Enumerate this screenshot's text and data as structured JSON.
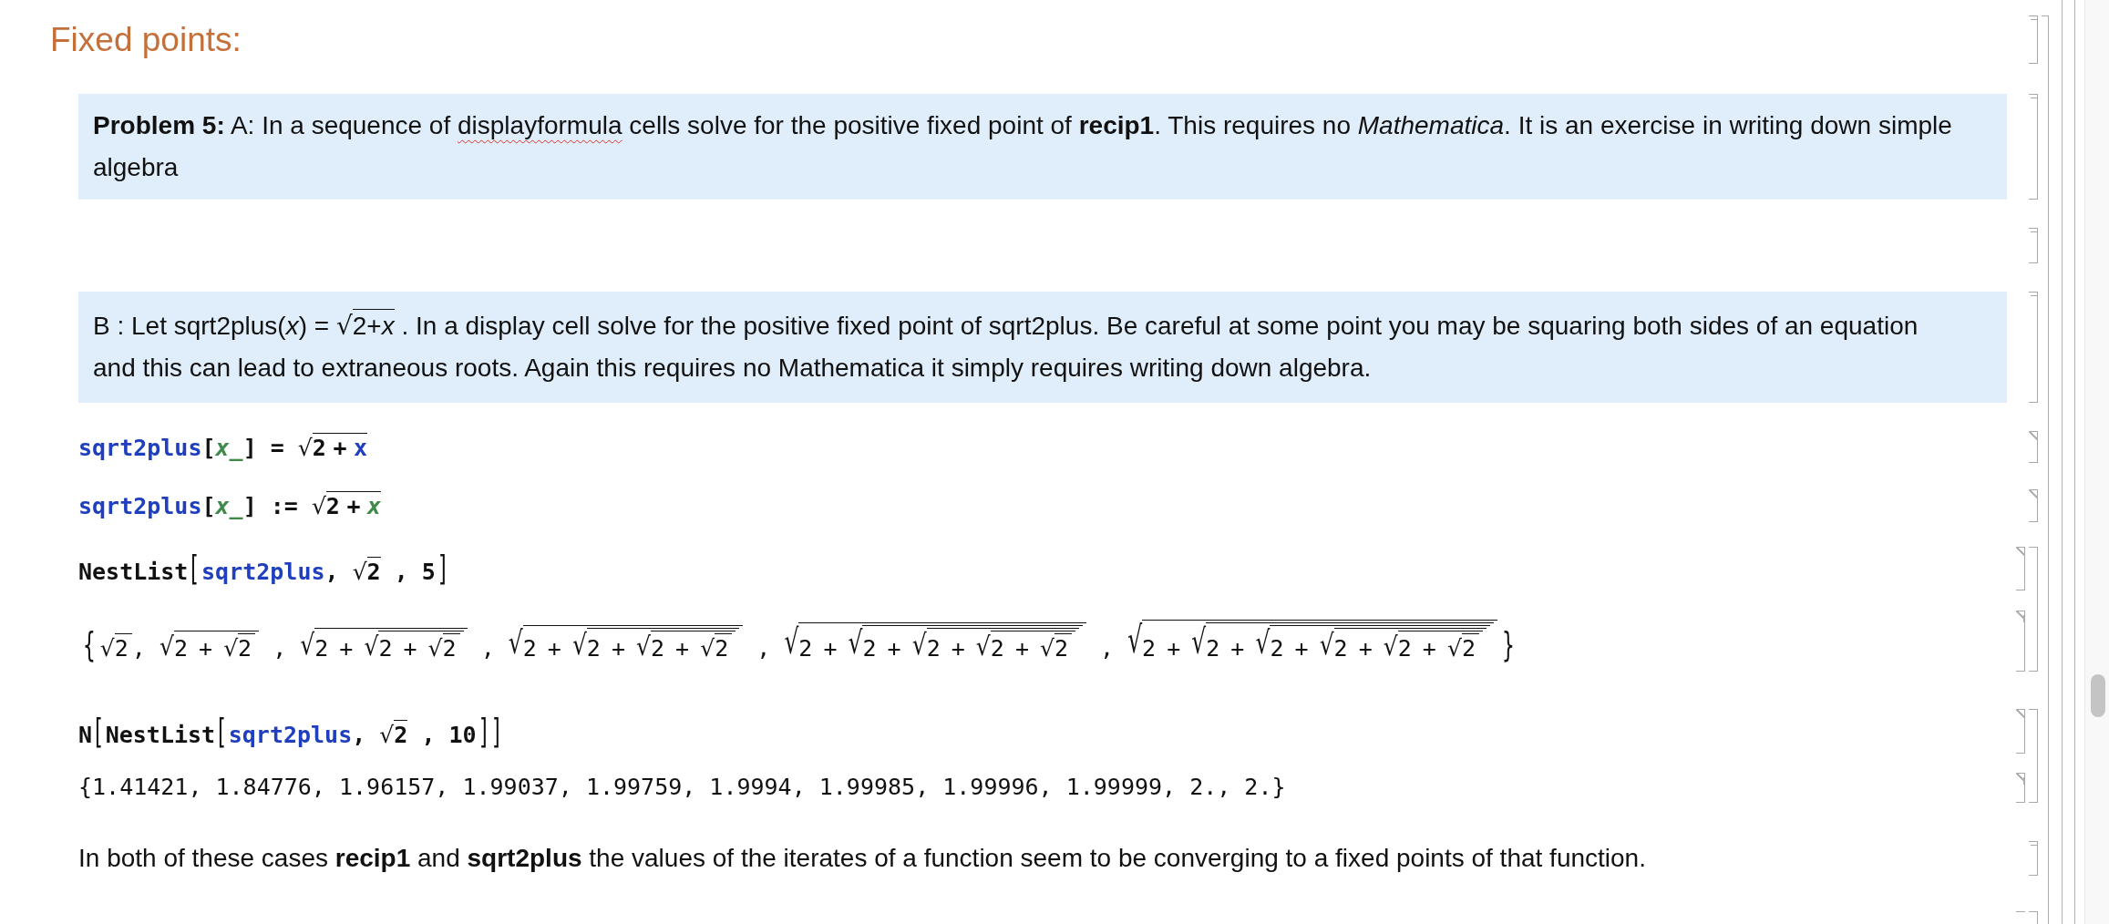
{
  "cells": [
    {
      "kind": "section_title",
      "title": "Fixed points:"
    },
    {
      "kind": "text_box",
      "paragraph": [
        {
          "kind": "bold",
          "text": "Problem 5:"
        },
        {
          "kind": "plain",
          "text": " A: In a sequence of "
        },
        {
          "kind": "misspelled",
          "text": "displayformula"
        },
        {
          "kind": "plain",
          "text": " cells solve for the positive fixed point of "
        },
        {
          "kind": "bold",
          "text": "recip1"
        },
        {
          "kind": "plain",
          "text": ". This requires no "
        },
        {
          "kind": "italic",
          "text": "Mathematica"
        },
        {
          "kind": "plain",
          "text": ". It is an exercise in writing down simple algebra"
        }
      ]
    },
    {
      "kind": "empty"
    },
    {
      "kind": "text_box",
      "paragraph": [
        {
          "kind": "plain",
          "text": "B : Let sqrt2plus("
        },
        {
          "kind": "italic",
          "text": "x"
        },
        {
          "kind": "plain",
          "text": ") = "
        },
        {
          "kind": "sqrt",
          "sign": "√",
          "body": [
            {
              "kind": "plain",
              "text": "2+"
            },
            {
              "kind": "italic",
              "text": "x"
            }
          ]
        },
        {
          "kind": "plain",
          "text": " . In a display cell solve for the positive fixed point of sqrt2plus. Be careful at some point you may be squaring both sides of an equation and this can lead to extraneous roots. Again this requires no Mathematica it simply requires writing down algebra."
        }
      ]
    },
    {
      "kind": "input",
      "code": [
        {
          "kind": "symbol",
          "text": "sqrt2plus"
        },
        {
          "kind": "plain",
          "text": "["
        },
        {
          "kind": "pattern",
          "text": "x_"
        },
        {
          "kind": "plain",
          "text": "] = "
        },
        {
          "kind": "sqrt",
          "sign": "√",
          "body": [
            {
              "kind": "plain",
              "text": "2 + "
            },
            {
              "kind": "symbol",
              "text": "x"
            }
          ]
        }
      ]
    },
    {
      "kind": "input",
      "code": [
        {
          "kind": "symbol",
          "text": "sqrt2plus"
        },
        {
          "kind": "plain",
          "text": "["
        },
        {
          "kind": "pattern",
          "text": "x_"
        },
        {
          "kind": "plain",
          "text": "] := "
        },
        {
          "kind": "sqrt",
          "sign": "√",
          "body": [
            {
              "kind": "plain",
              "text": "2 + "
            },
            {
              "kind": "pattern",
              "text": "x"
            }
          ]
        }
      ]
    },
    {
      "kind": "group",
      "cells": [
        {
          "kind": "input",
          "code": [
            {
              "kind": "plain",
              "text": "NestList"
            },
            {
              "kind": "big_bracket",
              "text": "["
            },
            {
              "kind": "symbol",
              "text": "sqrt2plus"
            },
            {
              "kind": "plain",
              "text": ", "
            },
            {
              "kind": "sqrt",
              "sign": "√",
              "body": [
                {
                  "kind": "plain",
                  "text": "2"
                }
              ]
            },
            {
              "kind": "plain",
              "text": " , 5"
            },
            {
              "kind": "big_bracket",
              "text": "]"
            }
          ]
        },
        {
          "kind": "output",
          "code": [
            {
              "kind": "big_bracket",
              "text": "{"
            },
            {
              "kind": "sqrt",
              "sign": "√",
              "body": [
                {
                  "kind": "plain",
                  "text": "2"
                }
              ]
            },
            {
              "kind": "plain",
              "text": ", "
            },
            {
              "kind": "sqrt",
              "sign": "√",
              "body": [
                {
                  "kind": "plain",
                  "text": "2 + "
                },
                {
                  "kind": "sqrt",
                  "sign": "√",
                  "body": [
                    {
                      "kind": "plain",
                      "text": "2"
                    }
                  ]
                }
              ]
            },
            {
              "kind": "plain",
              "text": " , "
            },
            {
              "kind": "sqrt",
              "sign": "√",
              "body": [
                {
                  "kind": "plain",
                  "text": "2 + "
                },
                {
                  "kind": "sqrt",
                  "sign": "√",
                  "body": [
                    {
                      "kind": "plain",
                      "text": "2 + "
                    },
                    {
                      "kind": "sqrt",
                      "sign": "√",
                      "body": [
                        {
                          "kind": "plain",
                          "text": "2"
                        }
                      ]
                    }
                  ]
                }
              ]
            },
            {
              "kind": "plain",
              "text": " , "
            },
            {
              "kind": "sqrt",
              "sign": "√",
              "body": [
                {
                  "kind": "plain",
                  "text": "2 + "
                },
                {
                  "kind": "sqrt",
                  "sign": "√",
                  "body": [
                    {
                      "kind": "plain",
                      "text": "2 + "
                    },
                    {
                      "kind": "sqrt",
                      "sign": "√",
                      "body": [
                        {
                          "kind": "plain",
                          "text": "2 + "
                        },
                        {
                          "kind": "sqrt",
                          "sign": "√",
                          "body": [
                            {
                              "kind": "plain",
                              "text": "2"
                            }
                          ]
                        }
                      ]
                    }
                  ]
                }
              ]
            },
            {
              "kind": "plain",
              "text": " , "
            },
            {
              "kind": "sqrt",
              "sign": "√",
              "body": [
                {
                  "kind": "plain",
                  "text": "2 + "
                },
                {
                  "kind": "sqrt",
                  "sign": "√",
                  "body": [
                    {
                      "kind": "plain",
                      "text": "2 + "
                    },
                    {
                      "kind": "sqrt",
                      "sign": "√",
                      "body": [
                        {
                          "kind": "plain",
                          "text": "2 + "
                        },
                        {
                          "kind": "sqrt",
                          "sign": "√",
                          "body": [
                            {
                              "kind": "plain",
                              "text": "2 + "
                            },
                            {
                              "kind": "sqrt",
                              "sign": "√",
                              "body": [
                                {
                                  "kind": "plain",
                                  "text": "2"
                                }
                              ]
                            }
                          ]
                        }
                      ]
                    }
                  ]
                }
              ]
            },
            {
              "kind": "plain",
              "text": " , "
            },
            {
              "kind": "sqrt",
              "sign": "√",
              "body": [
                {
                  "kind": "plain",
                  "text": "2 + "
                },
                {
                  "kind": "sqrt",
                  "sign": "√",
                  "body": [
                    {
                      "kind": "plain",
                      "text": "2 + "
                    },
                    {
                      "kind": "sqrt",
                      "sign": "√",
                      "body": [
                        {
                          "kind": "plain",
                          "text": "2 + "
                        },
                        {
                          "kind": "sqrt",
                          "sign": "√",
                          "body": [
                            {
                              "kind": "plain",
                              "text": "2 + "
                            },
                            {
                              "kind": "sqrt",
                              "sign": "√",
                              "body": [
                                {
                                  "kind": "plain",
                                  "text": "2 + "
                                },
                                {
                                  "kind": "sqrt",
                                  "sign": "√",
                                  "body": [
                                    {
                                      "kind": "plain",
                                      "text": "2"
                                    }
                                  ]
                                }
                              ]
                            }
                          ]
                        }
                      ]
                    }
                  ]
                }
              ]
            },
            {
              "kind": "big_bracket",
              "text": "}"
            }
          ]
        }
      ]
    },
    {
      "kind": "group",
      "cells": [
        {
          "kind": "input",
          "code": [
            {
              "kind": "plain",
              "text": "N"
            },
            {
              "kind": "big_bracket",
              "text": "["
            },
            {
              "kind": "plain",
              "text": "NestList"
            },
            {
              "kind": "big_bracket",
              "text": "["
            },
            {
              "kind": "symbol",
              "text": "sqrt2plus"
            },
            {
              "kind": "plain",
              "text": ", "
            },
            {
              "kind": "sqrt",
              "sign": "√",
              "body": [
                {
                  "kind": "plain",
                  "text": "2"
                }
              ]
            },
            {
              "kind": "plain",
              "text": " , 10"
            },
            {
              "kind": "big_bracket",
              "text": "]"
            },
            {
              "kind": "big_bracket",
              "text": "]"
            }
          ]
        },
        {
          "kind": "output",
          "code": [
            {
              "kind": "plain",
              "text": "{1.41421, 1.84776, 1.96157, 1.99037, 1.99759, 1.9994, 1.99985, 1.99996, 1.99999, 2., 2.}"
            }
          ]
        }
      ]
    },
    {
      "kind": "text",
      "paragraph": [
        {
          "kind": "plain",
          "text": "In both of these cases "
        },
        {
          "kind": "bold",
          "text": "recip1"
        },
        {
          "kind": "plain",
          "text": " and "
        },
        {
          "kind": "bold",
          "text": "sqrt2plus"
        },
        {
          "kind": "plain",
          "text": " the values of the iterates of a function seem to be converging to a fixed points of that function."
        }
      ]
    },
    {
      "kind": "group",
      "cells": [
        {
          "kind": "cut_off"
        }
      ]
    }
  ]
}
